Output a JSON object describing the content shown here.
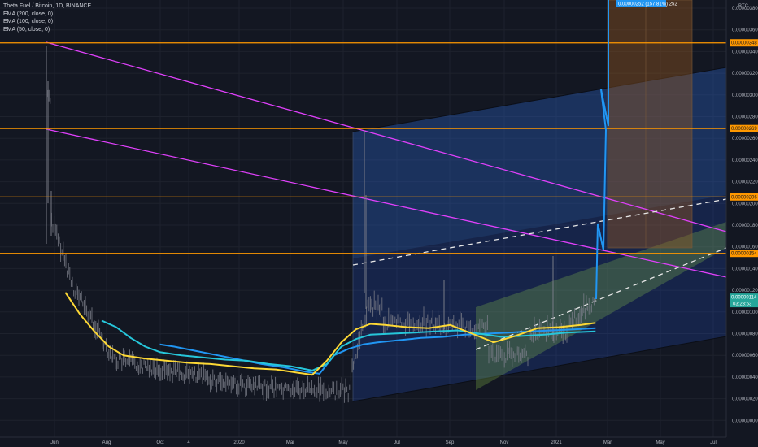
{
  "legend": {
    "title": "Theta Fuel / Bitcoin, 1D, BINANCE",
    "ema200": "EMA (200, close, 0)",
    "ema100": "EMA (100, close, 0)",
    "ema50": "EMA (50, close, 0)"
  },
  "currency": "BTC",
  "colors": {
    "background": "#131722",
    "grid": "#1e222d",
    "horizontal_levels": "#ff9800",
    "trendlines": "#e040fb",
    "channel_fill": "#2962ff",
    "channel_upper_fill": "#2a5a9a",
    "green_channel_fill": "#8bc34a",
    "projection_fill": "#9c5a1f",
    "projection_line": "#2196f3",
    "ema200": "#2196f3",
    "ema100": "#26c6da",
    "ema50": "#fdd835",
    "candles": "#787b86",
    "current_price_tag": "#26a69a",
    "projection_tag": "#2196f3"
  },
  "chart_data": {
    "type": "line",
    "title": "Theta Fuel / Bitcoin, 1D, BINANCE",
    "x_ticks": [
      "Jun",
      "Aug",
      "Oct",
      "4",
      "2020",
      "Mar",
      "May",
      "Jul",
      "Sep",
      "Nov",
      "2021",
      "Mar",
      "May",
      "Jul"
    ],
    "y_ticks": [
      "0.00000380",
      "0.00000360",
      "0.00000340",
      "0.00000320",
      "0.00000300",
      "0.00000280",
      "0.00000260",
      "0.00000240",
      "0.00000220",
      "0.00000200",
      "0.00000180",
      "0.00000160",
      "0.00000140",
      "0.00000120",
      "0.00000100",
      "0.00000080",
      "0.00000060",
      "0.00000040",
      "0.00000020",
      "0.00000000",
      "-0.00000020"
    ],
    "ylim": [
      -2e-07,
      3.8e-06
    ],
    "horizontal_levels": [
      {
        "label": "0.00000348",
        "value": 3.48e-06
      },
      {
        "label": "0.00000269",
        "value": 2.69e-06
      },
      {
        "label": "0.00000206",
        "value": 2.06e-06
      },
      {
        "label": "0.00000154",
        "value": 1.54e-06
      }
    ],
    "current_price": {
      "label": "0.00000114",
      "countdown": "03:23:53",
      "value": 1.14e-06
    },
    "projection_label": "0.00000252 (157.81%) 252",
    "series": [
      {
        "name": "EMA (200, close, 0)",
        "points": [
          [
            0.22,
            7e-07
          ],
          [
            0.24,
            6.8e-07
          ],
          [
            0.27,
            6.4e-07
          ],
          [
            0.3,
            6e-07
          ],
          [
            0.33,
            5.6e-07
          ],
          [
            0.36,
            5.2e-07
          ],
          [
            0.39,
            4.9e-07
          ],
          [
            0.42,
            4.5e-07
          ],
          [
            0.44,
            4.3e-07
          ],
          [
            0.46,
            6e-07
          ],
          [
            0.48,
            6.6e-07
          ],
          [
            0.5,
            7e-07
          ],
          [
            0.52,
            7.2e-07
          ],
          [
            0.55,
            7.4e-07
          ],
          [
            0.58,
            7.6e-07
          ],
          [
            0.61,
            7.7e-07
          ],
          [
            0.64,
            7.9e-07
          ],
          [
            0.67,
            8e-07
          ],
          [
            0.7,
            8.1e-07
          ],
          [
            0.73,
            8.2e-07
          ],
          [
            0.76,
            8.3e-07
          ],
          [
            0.79,
            8.4e-07
          ],
          [
            0.82,
            8.5e-07
          ]
        ]
      },
      {
        "name": "EMA (100, close, 0)",
        "points": [
          [
            0.14,
            9.2e-07
          ],
          [
            0.16,
            8.6e-07
          ],
          [
            0.18,
            7.6e-07
          ],
          [
            0.2,
            6.8e-07
          ],
          [
            0.22,
            6.3e-07
          ],
          [
            0.25,
            6e-07
          ],
          [
            0.28,
            5.8e-07
          ],
          [
            0.31,
            5.6e-07
          ],
          [
            0.34,
            5.5e-07
          ],
          [
            0.37,
            5.2e-07
          ],
          [
            0.4,
            5e-07
          ],
          [
            0.43,
            4.6e-07
          ],
          [
            0.45,
            5.2e-07
          ],
          [
            0.47,
            6.8e-07
          ],
          [
            0.49,
            7.5e-07
          ],
          [
            0.51,
            7.9e-07
          ],
          [
            0.54,
            8e-07
          ],
          [
            0.57,
            8.1e-07
          ],
          [
            0.6,
            8.2e-07
          ],
          [
            0.63,
            8.3e-07
          ],
          [
            0.66,
            8e-07
          ],
          [
            0.69,
            7.7e-07
          ],
          [
            0.72,
            7.8e-07
          ],
          [
            0.75,
            7.9e-07
          ],
          [
            0.78,
            8.1e-07
          ],
          [
            0.82,
            8.2e-07
          ]
        ]
      },
      {
        "name": "EMA (50, close, 0)",
        "points": [
          [
            0.09,
            1.18e-06
          ],
          [
            0.11,
            9.8e-07
          ],
          [
            0.13,
            8.2e-07
          ],
          [
            0.15,
            6.8e-07
          ],
          [
            0.17,
            6e-07
          ],
          [
            0.2,
            5.7e-07
          ],
          [
            0.23,
            5.5e-07
          ],
          [
            0.26,
            5.3e-07
          ],
          [
            0.29,
            5.2e-07
          ],
          [
            0.32,
            5e-07
          ],
          [
            0.35,
            4.8e-07
          ],
          [
            0.38,
            4.7e-07
          ],
          [
            0.41,
            4.4e-07
          ],
          [
            0.43,
            4.2e-07
          ],
          [
            0.45,
            5.5e-07
          ],
          [
            0.47,
            7.2e-07
          ],
          [
            0.49,
            8.4e-07
          ],
          [
            0.51,
            8.9e-07
          ],
          [
            0.53,
            8.8e-07
          ],
          [
            0.56,
            8.6e-07
          ],
          [
            0.59,
            8.5e-07
          ],
          [
            0.62,
            8.8e-07
          ],
          [
            0.65,
            8e-07
          ],
          [
            0.68,
            7.2e-07
          ],
          [
            0.71,
            7.8e-07
          ],
          [
            0.74,
            8.5e-07
          ],
          [
            0.77,
            8.6e-07
          ],
          [
            0.8,
            8.8e-07
          ],
          [
            0.82,
            9e-07
          ]
        ]
      }
    ]
  }
}
